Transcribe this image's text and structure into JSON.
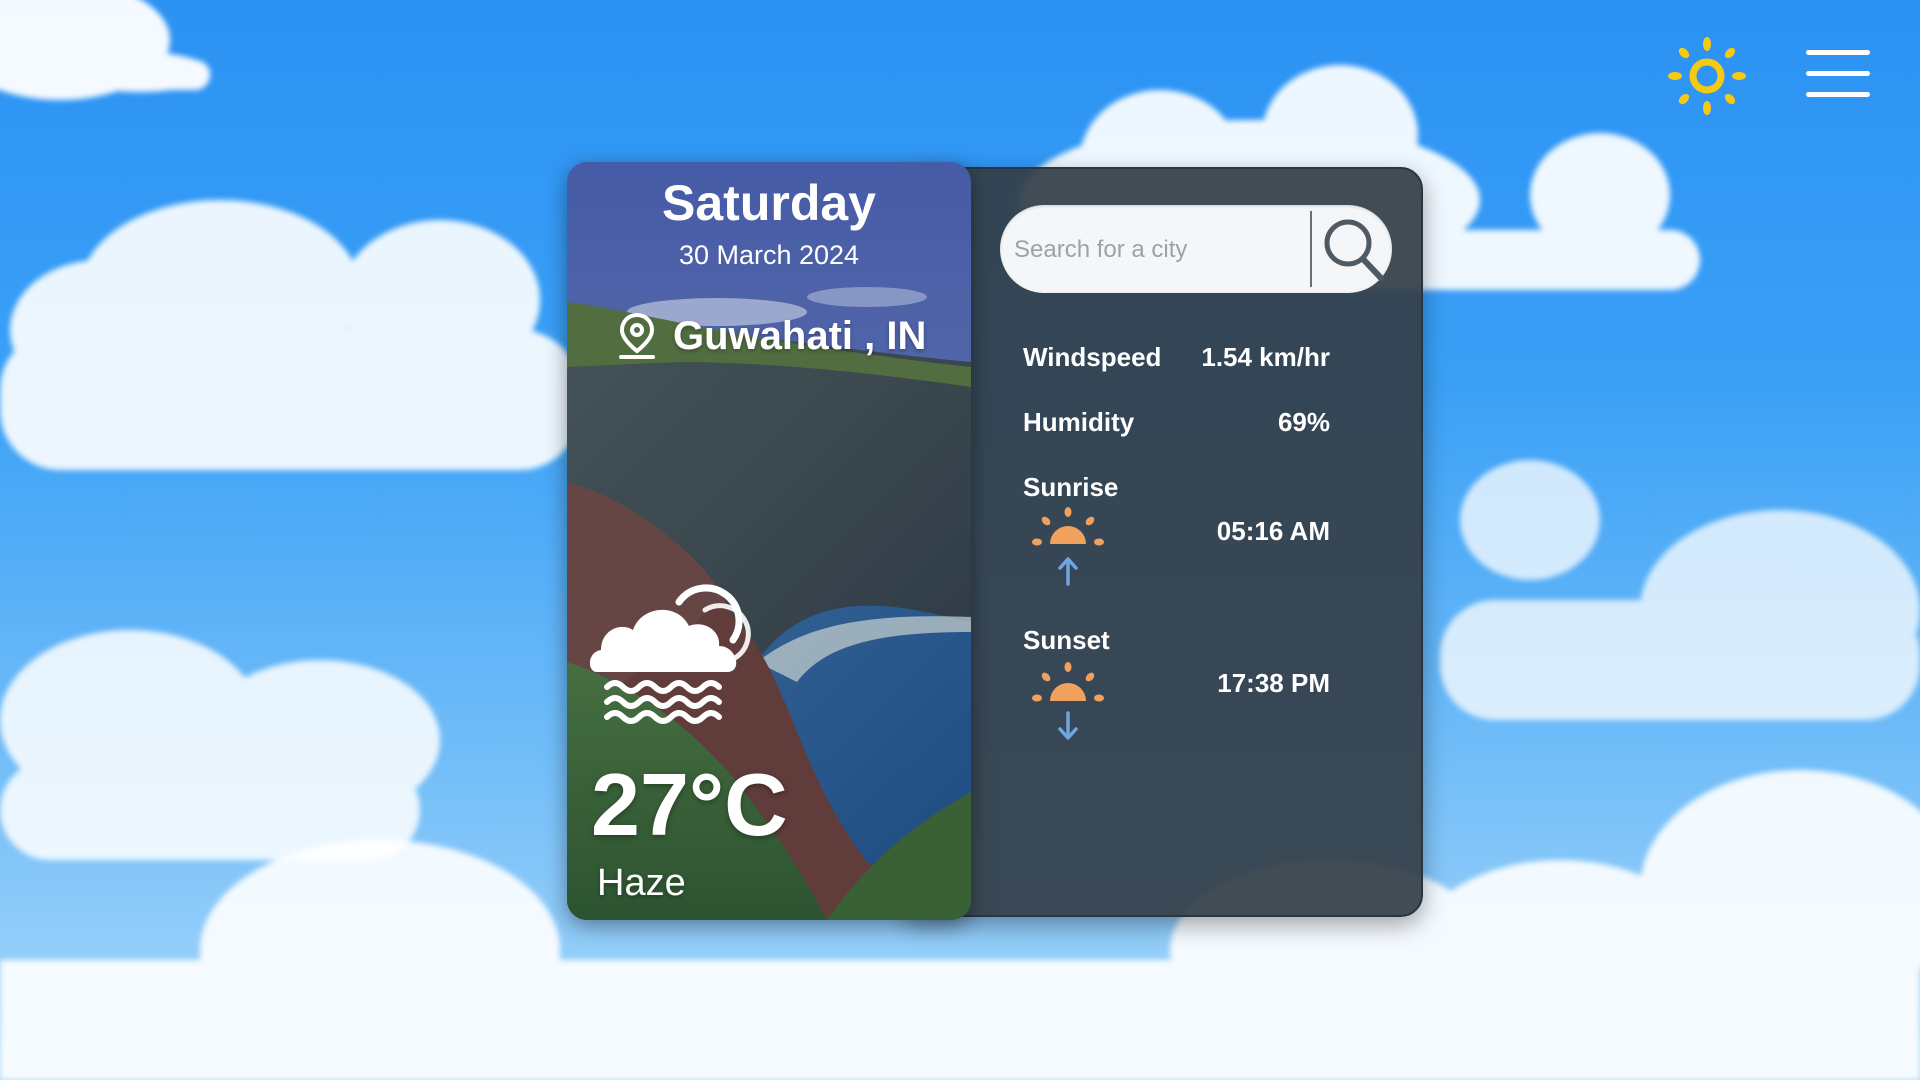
{
  "header": {
    "theme_icon": "sun-icon",
    "menu_icon": "hamburger-menu-icon"
  },
  "weather": {
    "day": "Saturday",
    "date": "30 March 2024",
    "location": "Guwahati , IN",
    "temperature": "27°C",
    "condition": "Haze",
    "condition_icon": "cloud-fog-icon"
  },
  "search": {
    "placeholder": "Search for a city",
    "icon": "magnifier-icon"
  },
  "details": {
    "windspeed_label": "Windspeed",
    "windspeed_value": "1.54 km/hr",
    "humidity_label": "Humidity",
    "humidity_value": "69%",
    "sunrise_label": "Sunrise",
    "sunrise_value": "05:16 AM",
    "sunrise_icon": "sunrise-icon",
    "sunset_label": "Sunset",
    "sunset_value": "17:38 PM",
    "sunset_icon": "sunset-icon"
  },
  "colors": {
    "accent_sun": "#f6c912",
    "sun_icon_orange": "#f0a15e",
    "arrow_blue": "#6fa6e0",
    "panel_bg": "#343e48"
  }
}
